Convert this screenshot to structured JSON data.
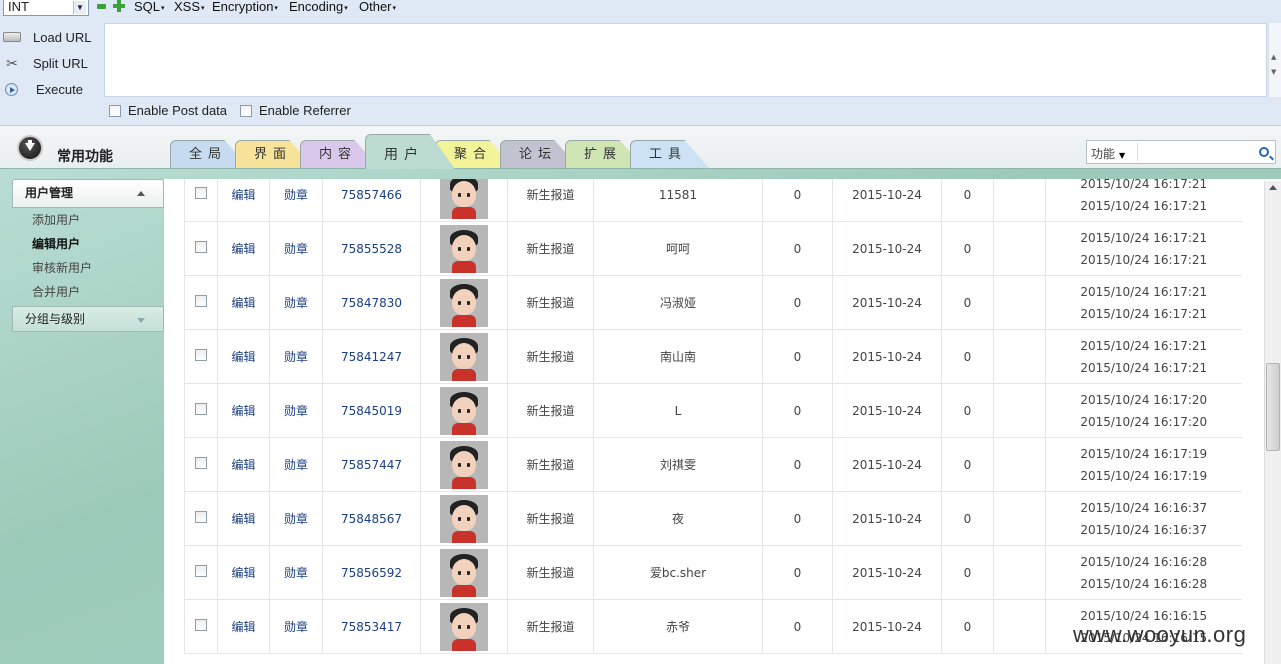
{
  "hackbar": {
    "type_select": "INT",
    "menus": [
      "SQL",
      "XSS",
      "Encryption",
      "Encoding",
      "Other"
    ],
    "actions": [
      "Load URL",
      "Split URL",
      "Execute"
    ],
    "url_value": "",
    "checkboxes": [
      "Enable Post data",
      "Enable Referrer"
    ]
  },
  "admin": {
    "common_label": "常用功能",
    "tabs": [
      "全局",
      "界面",
      "内容",
      "用户",
      "聚合",
      "论坛",
      "扩展",
      "工具"
    ],
    "active_tab": "用户",
    "tab_colors": [
      "#c6daf0",
      "#f7e49a",
      "#d9c8ec",
      "#bcdcd2",
      "#f3f39a",
      "#c2c2d0",
      "#cfe6b4",
      "#cce2f4"
    ],
    "search_select": "功能"
  },
  "sidebar": {
    "section1": "用户管理",
    "items": [
      "添加用户",
      "编辑用户",
      "审核新用户",
      "合并用户"
    ],
    "active_item": "编辑用户",
    "section2": "分组与级别"
  },
  "rows": [
    {
      "edit": "编辑",
      "medal": "勋章",
      "uid": "75857466",
      "group": "新生报道",
      "name": "11581",
      "n1": "0",
      "date": "2015-10-24",
      "n2": "0",
      "t1": "2015/10/24 16:17:21",
      "t2": "2015/10/24 16:17:21"
    },
    {
      "edit": "编辑",
      "medal": "勋章",
      "uid": "75855528",
      "group": "新生报道",
      "name": "呵呵",
      "n1": "0",
      "date": "2015-10-24",
      "n2": "0",
      "t1": "2015/10/24 16:17:21",
      "t2": "2015/10/24 16:17:21"
    },
    {
      "edit": "编辑",
      "medal": "勋章",
      "uid": "75847830",
      "group": "新生报道",
      "name": "冯淑娅",
      "n1": "0",
      "date": "2015-10-24",
      "n2": "0",
      "t1": "2015/10/24 16:17:21",
      "t2": "2015/10/24 16:17:21"
    },
    {
      "edit": "编辑",
      "medal": "勋章",
      "uid": "75841247",
      "group": "新生报道",
      "name": "南山南",
      "n1": "0",
      "date": "2015-10-24",
      "n2": "0",
      "t1": "2015/10/24 16:17:21",
      "t2": "2015/10/24 16:17:21"
    },
    {
      "edit": "编辑",
      "medal": "勋章",
      "uid": "75845019",
      "group": "新生报道",
      "name": "L",
      "n1": "0",
      "date": "2015-10-24",
      "n2": "0",
      "t1": "2015/10/24 16:17:20",
      "t2": "2015/10/24 16:17:20"
    },
    {
      "edit": "编辑",
      "medal": "勋章",
      "uid": "75857447",
      "group": "新生报道",
      "name": "刘祺雯",
      "n1": "0",
      "date": "2015-10-24",
      "n2": "0",
      "t1": "2015/10/24 16:17:19",
      "t2": "2015/10/24 16:17:19"
    },
    {
      "edit": "编辑",
      "medal": "勋章",
      "uid": "75848567",
      "group": "新生报道",
      "name": "夜",
      "n1": "0",
      "date": "2015-10-24",
      "n2": "0",
      "t1": "2015/10/24 16:16:37",
      "t2": "2015/10/24 16:16:37"
    },
    {
      "edit": "编辑",
      "medal": "勋章",
      "uid": "75856592",
      "group": "新生报道",
      "name": "爱bc.sher",
      "n1": "0",
      "date": "2015-10-24",
      "n2": "0",
      "t1": "2015/10/24 16:16:28",
      "t2": "2015/10/24 16:16:28"
    },
    {
      "edit": "编辑",
      "medal": "勋章",
      "uid": "75853417",
      "group": "新生报道",
      "name": "赤爷",
      "n1": "0",
      "date": "2015-10-24",
      "n2": "0",
      "t1": "2015/10/24 16:16:15",
      "t2": "2015/10/24 16:16:15"
    }
  ],
  "watermark": "www.wooyun.org"
}
